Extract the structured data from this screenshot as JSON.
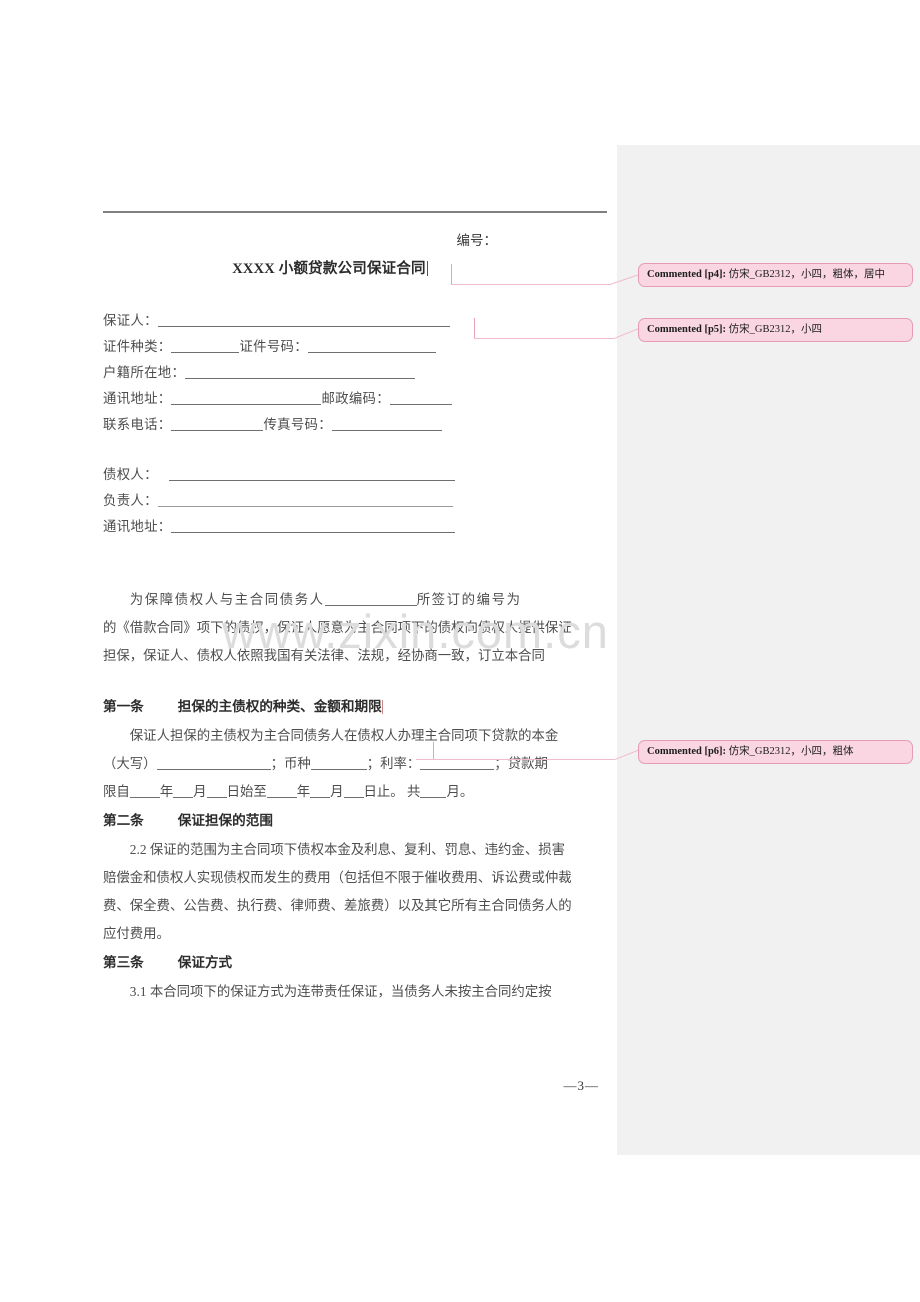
{
  "document": {
    "serial_label": "编号：",
    "title": "XXXX 小额贷款公司保证合同",
    "page_number": "—3—",
    "watermark": "www.zixin.com.cn"
  },
  "guarantor_fields": {
    "guarantor": "保证人：",
    "id_type": "证件种类：",
    "id_number": "证件号码：",
    "domicile": "户籍所在地：",
    "mailing_address": "通讯地址：",
    "postal_code": "邮政编码：",
    "phone": "联系电话：",
    "fax": "传真号码："
  },
  "creditor_fields": {
    "creditor": "债权人：",
    "responsible_person": "负责人：",
    "mailing_address": "通讯地址："
  },
  "preamble": {
    "line1_a": "为保障债权人与主合同债务人",
    "line1_b": "所签订的编号为",
    "line2": "的《借款合同》项下的债权，保证人愿意为主合同项下的债权向债权人提供保证",
    "line3": "担保，保证人、债权人依照我国有关法律、法规，经协商一致，订立本合同"
  },
  "clauses": [
    {
      "number": "第一条",
      "title": "担保的主债权的种类、金额和期限",
      "body_line1": "保证人担保的主债权为主合同债务人在债权人办理主合同项下贷款的本金",
      "body_line2_a": "（大写）",
      "body_line2_b": "；币种",
      "body_line2_c": "；利率：",
      "body_line2_d": "；贷款期",
      "body_line3_a": "限自",
      "body_line3_b": "年",
      "body_line3_c": "月",
      "body_line3_d": "日始至",
      "body_line3_e": "年",
      "body_line3_f": "月",
      "body_line3_g": "日止。 共",
      "body_line3_h": "月。"
    },
    {
      "number": "第二条",
      "title": "保证担保的范围",
      "body_line1": "2.2 保证的范围为主合同项下债权本金及利息、复利、罚息、违约金、损害",
      "body_line2": "赔偿金和债权人实现债权而发生的费用（包括但不限于催收费用、诉讼费或仲裁",
      "body_line3": "费、保全费、公告费、执行费、律师费、差旅费）以及其它所有主合同债务人的",
      "body_line4": "应付费用。"
    },
    {
      "number": "第三条",
      "title": "保证方式",
      "body_line1": "3.1 本合同项下的保证方式为连带责任保证，当债务人未按主合同约定按"
    }
  ],
  "comments": [
    {
      "tag": "Commented [p4]:",
      "text": "仿宋_GB2312，小四，粗体，居中"
    },
    {
      "tag": "Commented [p5]:",
      "text": "仿宋_GB2312，小四"
    },
    {
      "tag": "Commented [p6]:",
      "text": "仿宋_GB2312，小四，粗体"
    }
  ],
  "colors": {
    "comment_fill": "#f9d6e1",
    "comment_border": "#e79cb6",
    "margin_panel": "#f1f1f1",
    "watermark": "#dcdcdc",
    "rule": "#808080"
  }
}
